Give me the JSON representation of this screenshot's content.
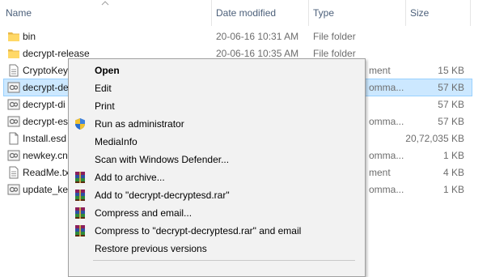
{
  "columns": {
    "name": "Name",
    "date": "Date modified",
    "type": "Type",
    "size": "Size"
  },
  "files": [
    {
      "name": "bin",
      "date": "20-06-16 10:31 AM",
      "type": "File folder",
      "type_tail": "",
      "size": "",
      "icon": "folder-icon"
    },
    {
      "name": "decrypt-release",
      "date": "20-06-16 10:35 AM",
      "type": "File folder",
      "type_tail": "",
      "size": "",
      "icon": "folder-icon"
    },
    {
      "name": "CryptoKey",
      "date": "",
      "type": "",
      "type_tail": "ment",
      "size": "15 KB",
      "icon": "document-icon"
    },
    {
      "name": "decrypt-de",
      "date": "",
      "type": "",
      "type_tail": "omma...",
      "size": "57 KB",
      "icon": "script-icon",
      "selected": true
    },
    {
      "name": "decrypt-di",
      "date": "",
      "type": "",
      "type_tail": "",
      "size": "57 KB",
      "icon": "script-icon"
    },
    {
      "name": "decrypt-es",
      "date": "",
      "type": "",
      "type_tail": "omma...",
      "size": "57 KB",
      "icon": "script-icon"
    },
    {
      "name": "Install.esd",
      "date": "",
      "type": "",
      "type_tail": "",
      "size": "20,72,035 KB",
      "icon": "file-icon"
    },
    {
      "name": "newkey.cn",
      "date": "",
      "type": "",
      "type_tail": "omma...",
      "size": "1 KB",
      "icon": "script-icon"
    },
    {
      "name": "ReadMe.tx",
      "date": "",
      "type": "",
      "type_tail": "ment",
      "size": "4 KB",
      "icon": "document-icon"
    },
    {
      "name": "update_ke",
      "date": "",
      "type": "",
      "type_tail": "omma...",
      "size": "1 KB",
      "icon": "script-icon"
    }
  ],
  "context_menu": {
    "items": [
      {
        "label": "Open",
        "icon": "",
        "default": true
      },
      {
        "label": "Edit",
        "icon": ""
      },
      {
        "label": "Print",
        "icon": ""
      },
      {
        "label": "Run as administrator",
        "icon": "uac-shield-icon"
      },
      {
        "label": "MediaInfo",
        "icon": ""
      },
      {
        "label": "Scan with Windows Defender...",
        "icon": ""
      },
      {
        "label": "Add to archive...",
        "icon": "winrar-icon"
      },
      {
        "label": "Add to \"decrypt-decryptesd.rar\"",
        "icon": "winrar-icon"
      },
      {
        "label": "Compress and email...",
        "icon": "winrar-icon"
      },
      {
        "label": "Compress to \"decrypt-decryptesd.rar\" and email",
        "icon": "winrar-icon"
      },
      {
        "label": "Restore previous versions",
        "icon": ""
      }
    ]
  },
  "colors": {
    "header_text": "#4c607a",
    "selection_bg": "#cce8ff",
    "selection_border": "#99d1ff",
    "menu_bg": "#f2f2f2",
    "folder_yellow": "#ffd866"
  }
}
